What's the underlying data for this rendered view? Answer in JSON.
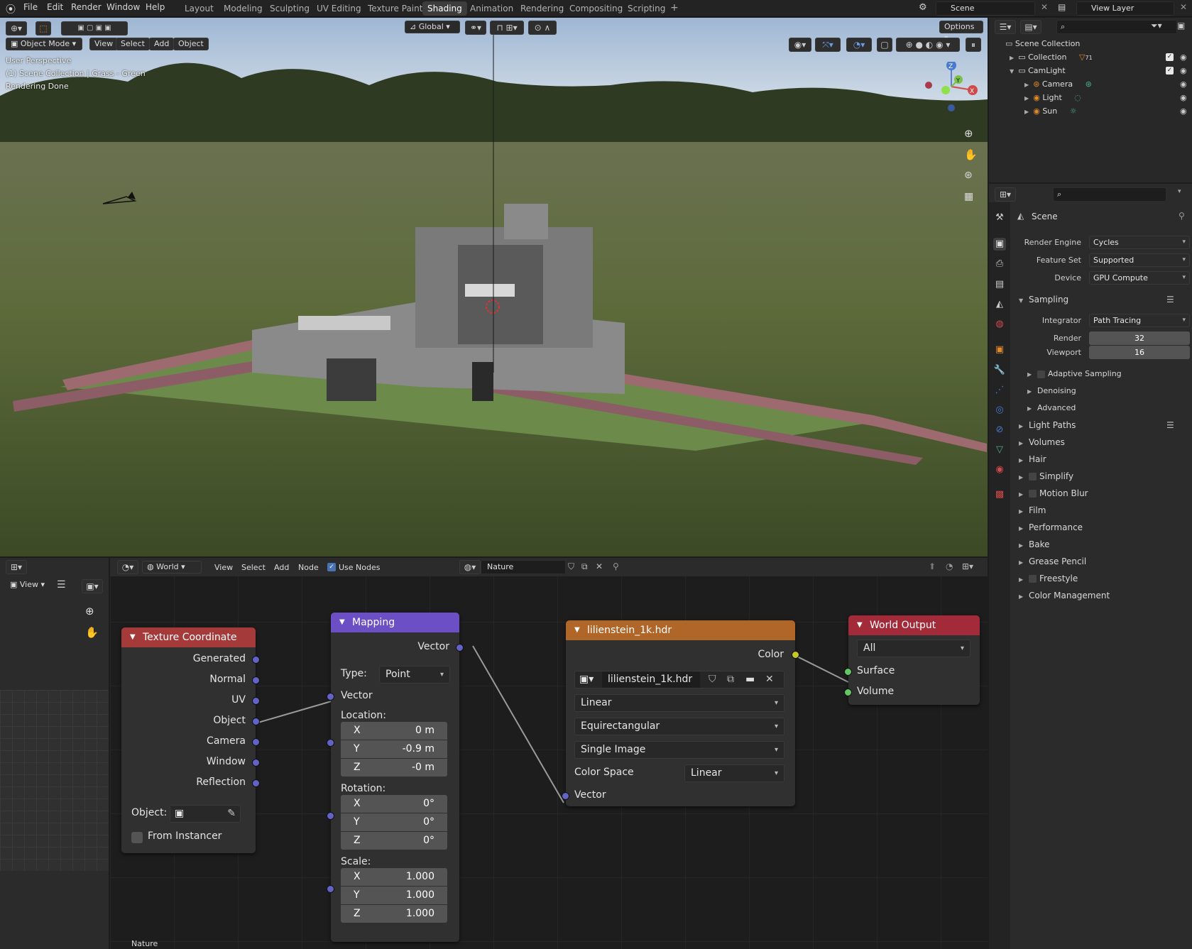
{
  "menu": {
    "file": "File",
    "edit": "Edit",
    "render": "Render",
    "window": "Window",
    "help": "Help"
  },
  "workspaces": [
    "Layout",
    "Modeling",
    "Sculpting",
    "UV Editing",
    "Texture Paint",
    "Shading",
    "Animation",
    "Rendering",
    "Compositing",
    "Scripting"
  ],
  "active_workspace": "Shading",
  "top_right": {
    "scene": "Scene",
    "view_layer": "View Layer"
  },
  "viewport_header": {
    "mode": "Object Mode",
    "view": "View",
    "select": "Select",
    "add": "Add",
    "object": "Object",
    "transform": "Global",
    "options": "Options"
  },
  "viewport_info": {
    "line1": "User Perspective",
    "line2": "(1) Scene Collection | Grass - Green",
    "line3": "Rendering Done"
  },
  "outliner": {
    "title": "Scene Collection",
    "rows": [
      {
        "label": "Collection",
        "badge": "71"
      },
      {
        "label": "CamLight"
      },
      {
        "label": "Camera"
      },
      {
        "label": "Light"
      },
      {
        "label": "Sun"
      }
    ]
  },
  "properties": {
    "context": "Scene",
    "render_engine_label": "Render Engine",
    "render_engine": "Cycles",
    "feature_set_label": "Feature Set",
    "feature_set": "Supported",
    "device_label": "Device",
    "device": "GPU Compute",
    "sampling": "Sampling",
    "integrator_label": "Integrator",
    "integrator": "Path Tracing",
    "render_label": "Render",
    "render_samples": "32",
    "viewport_label": "Viewport",
    "viewport_samples": "16",
    "sub": [
      "Adaptive Sampling",
      "Denoising",
      "Advanced"
    ],
    "sections": [
      "Light Paths",
      "Volumes",
      "Hair",
      "Simplify",
      "Motion Blur",
      "Film",
      "Performance",
      "Bake",
      "Grease Pencil",
      "Freestyle",
      "Color Management"
    ]
  },
  "node_editor_header": {
    "view": "View",
    "world": "World",
    "view2": "View",
    "select": "Select",
    "add": "Add",
    "node": "Node",
    "use_nodes": "Use Nodes",
    "world_name": "Nature"
  },
  "nodes": {
    "texcoord": {
      "title": "Texture Coordinate",
      "outputs": [
        "Generated",
        "Normal",
        "UV",
        "Object",
        "Camera",
        "Window",
        "Reflection"
      ],
      "object_label": "Object:",
      "from_instancer": "From Instancer"
    },
    "mapping": {
      "title": "Mapping",
      "out": "Vector",
      "type_label": "Type:",
      "type": "Point",
      "vector_in": "Vector",
      "location": "Location:",
      "rotation": "Rotation:",
      "scale": "Scale:",
      "loc": {
        "x": "0 m",
        "y": "-0.9 m",
        "z": "-0 m"
      },
      "rot": {
        "x": "0°",
        "y": "0°",
        "z": "0°"
      },
      "scl": {
        "x": "1.000",
        "y": "1.000",
        "z": "1.000"
      },
      "axis": {
        "x": "X",
        "y": "Y",
        "z": "Z"
      }
    },
    "envtex": {
      "title": "lilienstein_1k.hdr",
      "color": "Color",
      "image": "lilienstein_1k.hdr",
      "interp": "Linear",
      "proj": "Equirectangular",
      "source": "Single Image",
      "cs_label": "Color Space",
      "cs": "Linear",
      "vector": "Vector"
    },
    "output": {
      "title": "World Output",
      "target": "All",
      "surface": "Surface",
      "volume": "Volume"
    }
  },
  "footer": {
    "world_name": "Nature"
  },
  "colors": {
    "texcoord_hdr": "#a53a3a",
    "mapping_hdr": "#6c4fc4",
    "envtex_hdr": "#b06628",
    "output_hdr": "#a32a38",
    "accent": "#4772b3"
  }
}
